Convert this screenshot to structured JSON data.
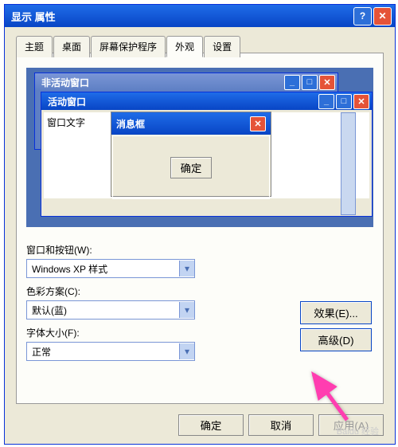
{
  "dialog": {
    "title": "显示 属性"
  },
  "tabs": {
    "items": [
      "主题",
      "桌面",
      "屏幕保护程序",
      "外观",
      "设置"
    ],
    "active": 3
  },
  "preview": {
    "inactive_window": "非活动窗口",
    "active_window": "活动窗口",
    "window_text": "窗口文字",
    "message_box": "消息框",
    "ok": "确定"
  },
  "form": {
    "windows_buttons_label": "窗口和按钮(W):",
    "windows_style": "Windows XP 样式",
    "color_scheme_label": "色彩方案(C):",
    "color_scheme": "默认(蓝)",
    "font_size_label": "字体大小(F):",
    "font_size": "正常"
  },
  "buttons": {
    "effects": "效果(E)...",
    "advanced": "高级(D)",
    "ok": "确定",
    "cancel": "取消",
    "apply": "应用(A)"
  },
  "watermark": "Baidu 经验"
}
